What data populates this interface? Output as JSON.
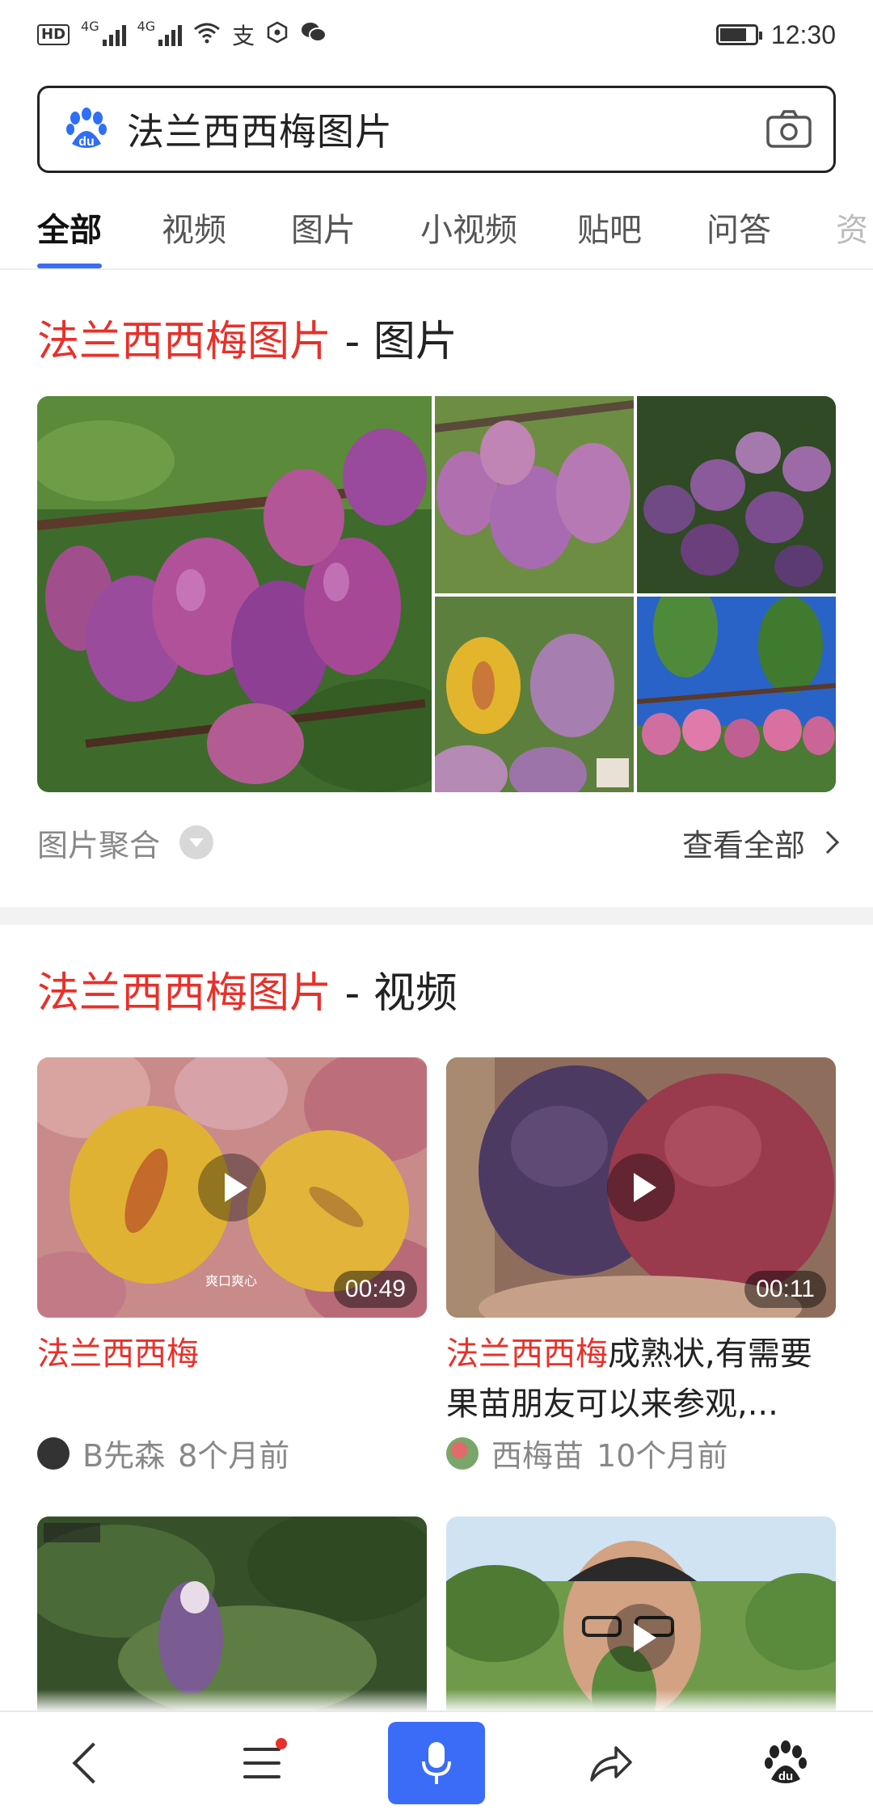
{
  "status_bar": {
    "badge": "HD",
    "network_1": "4G",
    "network_2": "4G",
    "time": "12:30",
    "icons": [
      "hd-icon",
      "signal-icon",
      "wifi-icon",
      "alipay-icon",
      "location-icon",
      "wechat-icon",
      "battery-icon"
    ]
  },
  "search": {
    "query": "法兰西西梅图片",
    "logo_text": "du"
  },
  "tabs": [
    {
      "label": "全部",
      "active": true
    },
    {
      "label": "视频",
      "active": false
    },
    {
      "label": "图片",
      "active": false
    },
    {
      "label": "小视频",
      "active": false
    },
    {
      "label": "贴吧",
      "active": false
    },
    {
      "label": "问答",
      "active": false
    },
    {
      "label": "资",
      "active": false
    }
  ],
  "image_section": {
    "title_highlight": "法兰西西梅图片",
    "title_rest": " - 图片",
    "footer_left": "图片聚合",
    "footer_right": "查看全部"
  },
  "video_section": {
    "title_highlight": "法兰西西梅图片",
    "title_rest": " - 视频",
    "videos": [
      {
        "title_highlight": "法兰西西梅",
        "title_rest": "",
        "duration": "00:49",
        "author": "B先森",
        "time": "8个月前",
        "overlay_text": "爽口爽心"
      },
      {
        "title_highlight": "法兰西西梅",
        "title_rest": "成熟状,有需要果苗朋友可以来参观,...",
        "duration": "00:11",
        "author": "西梅苗",
        "time": "10个月前"
      }
    ]
  },
  "colors": {
    "highlight": "#e8302a",
    "accent": "#3b6cf7"
  }
}
